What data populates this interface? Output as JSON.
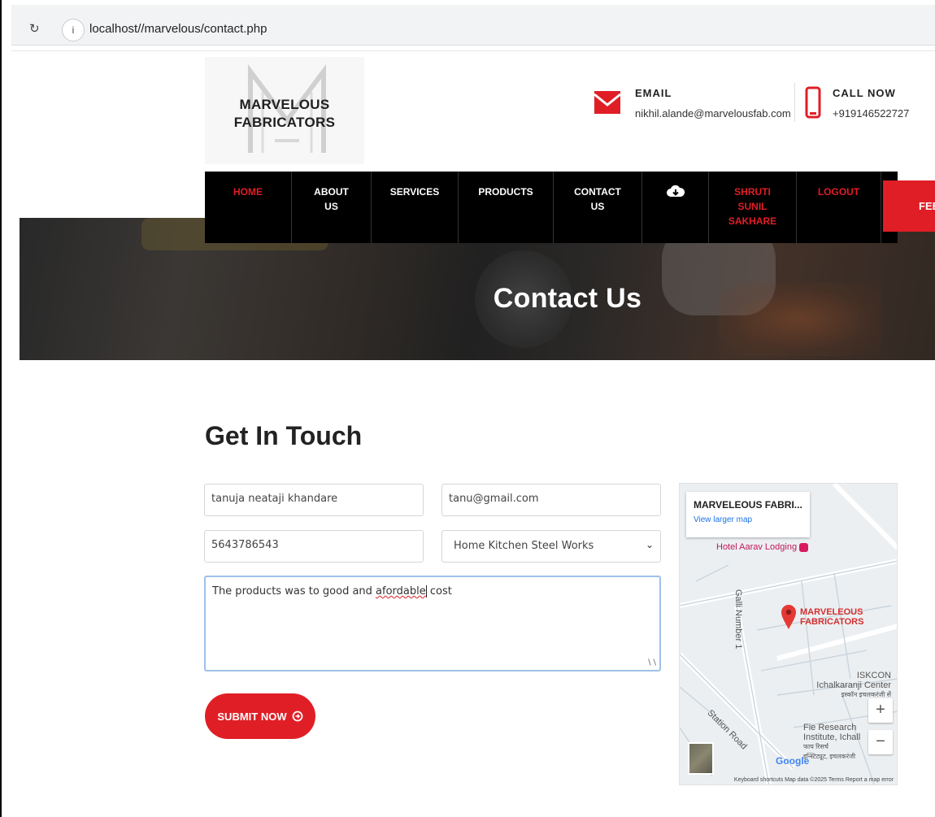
{
  "browser": {
    "url": "localhost//marvelous/contact.php",
    "reload_icon": "reload-icon",
    "info_icon": "info-icon"
  },
  "brand": {
    "line1": "MARVELOUS",
    "line2": "FABRICATORS"
  },
  "contact": {
    "email_label": "EMAIL",
    "email_value": "nikhil.alande@marvelousfab.com",
    "call_label": "CALL NOW",
    "call_value": "+919146522727"
  },
  "nav": {
    "items": [
      {
        "label": "HOME"
      },
      {
        "label": "ABOUT\nUS"
      },
      {
        "label": "SERVICES"
      },
      {
        "label": "PRODUCTS"
      },
      {
        "label": "CONTACT\nUS"
      },
      {
        "label": ""
      },
      {
        "label": "SHRUTI\nSUNIL\nSAKHARE"
      },
      {
        "label": "LOGOUT"
      }
    ],
    "feedback": "FEEDB"
  },
  "hero": {
    "title": "Contact Us"
  },
  "form": {
    "title": "Get In Touch",
    "name": "tanuja neataji khandare",
    "email": "tanu@gmail.com",
    "phone": "5643786543",
    "service": "Home Kitchen Steel Works",
    "message_before": "The products was to good and ",
    "message_misspelled": "afordable",
    "message_after": " cost",
    "submit": "SUBMIT NOW"
  },
  "map": {
    "card_title": "MARVELEOUS FABRI...",
    "card_link": "View larger map",
    "hotel": "Hotel Aarav Lodging",
    "place_line1": "MARVELEOUS",
    "place_line2": "FABRICATORS",
    "iskcon_line1": "ISKCON",
    "iskcon_line2": "Ichalkaranji Center",
    "iskcon_line3": "इस्कॉन इचलकरंजी सें",
    "fie_line1": "Fie Research",
    "fie_line2": "Institute, Ichall",
    "fie_line3": "फाय रिसर्च",
    "fie_line4": "इन्स्टिट्यूट, इचलकरंजी",
    "station": "Station Road",
    "galli": "Galli Number 1",
    "google": "Google",
    "attribution": "Keyboard shortcuts   Map data ©2025   Terms   Report a map error"
  },
  "colors": {
    "accent": "#e01e26",
    "nav_bg": "#000000",
    "link": "#1a73e8"
  }
}
